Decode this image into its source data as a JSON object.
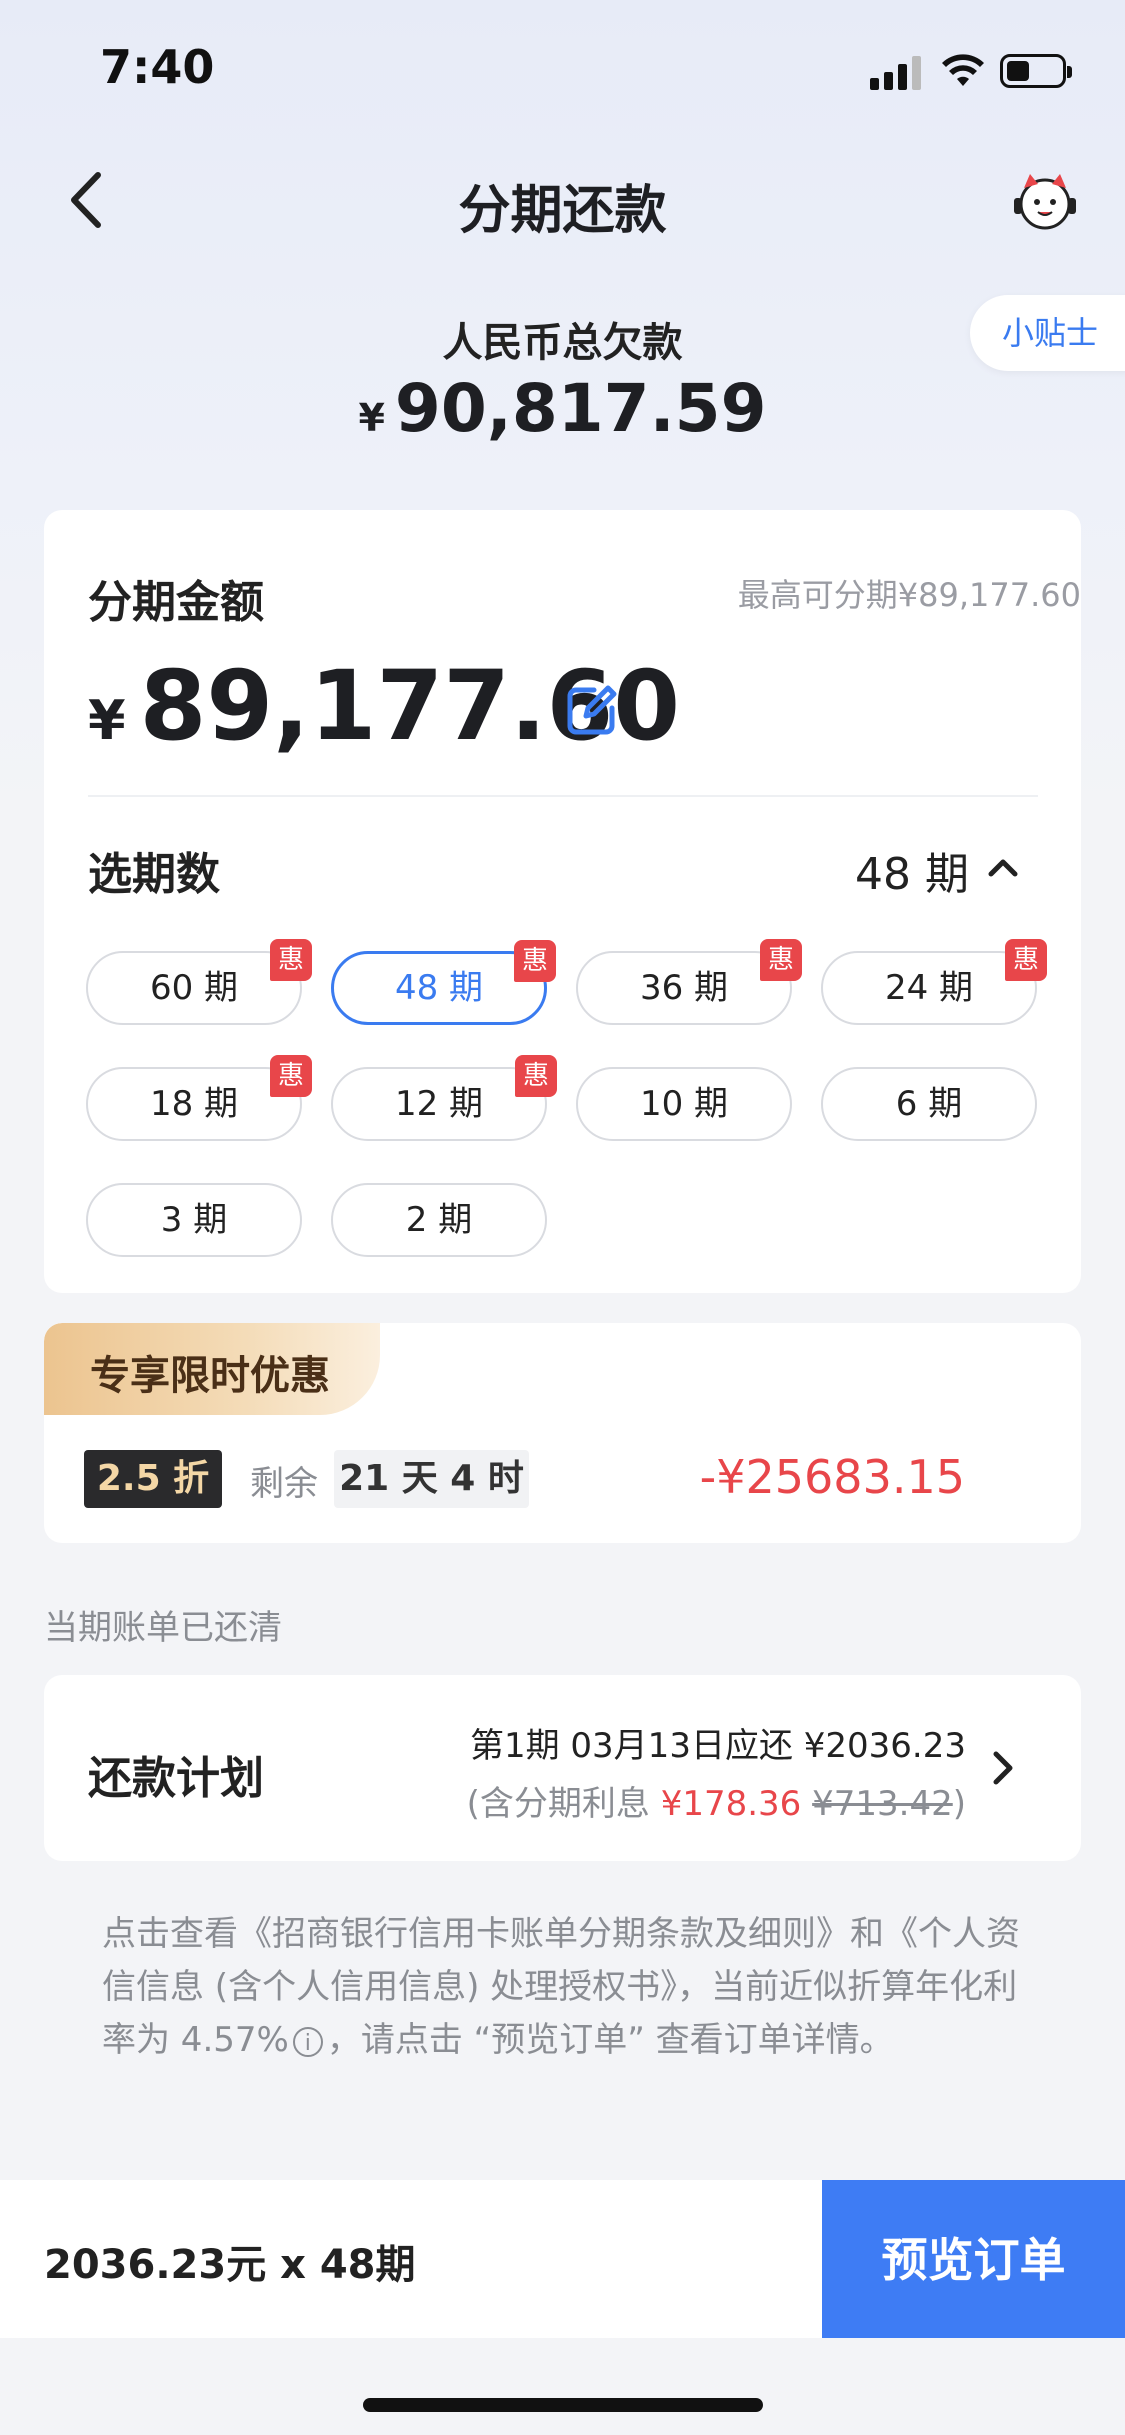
{
  "status_bar": {
    "time": "7:40"
  },
  "nav": {
    "title": "分期还款"
  },
  "header": {
    "tips_label": "小贴士",
    "total_label": "人民币总欠款",
    "currency": "¥",
    "total_amount": "90,817.59"
  },
  "amount_section": {
    "label": "分期金额",
    "max_text": "最高可分期¥89,177.60",
    "currency": "¥",
    "amount": "89,177.60"
  },
  "period_section": {
    "label": "选期数",
    "selected": "48 期",
    "options": [
      {
        "label": "60 期",
        "badge": "惠"
      },
      {
        "label": "48 期",
        "badge": "惠"
      },
      {
        "label": "36 期",
        "badge": "惠"
      },
      {
        "label": "24 期",
        "badge": "惠"
      },
      {
        "label": "18 期",
        "badge": "惠"
      },
      {
        "label": "12 期",
        "badge": "惠"
      },
      {
        "label": "10 期",
        "badge": ""
      },
      {
        "label": "6 期",
        "badge": ""
      },
      {
        "label": "3 期",
        "badge": ""
      },
      {
        "label": "2 期",
        "badge": ""
      }
    ]
  },
  "promo": {
    "title": "专享限时优惠",
    "discount": "2.5 折",
    "remain_label": "剩余",
    "remain_time": "21 天 4 时",
    "saving": "-¥25683.15"
  },
  "bill_notice": "当期账单已还清",
  "plan": {
    "label": "还款计划",
    "line1": "第1期 03月13日应还 ¥2036.23",
    "line2_prefix": "(含分期利息 ",
    "interest": "¥178.36",
    "original_interest": "¥713.42",
    "line2_suffix": ")"
  },
  "terms": {
    "part1": "点击查看《招商银行信用卡账单分期条款及细则》和《个人资信信息 (含个人信用信息) 处理授权书》，当前近似折算年化利率为 4.57%",
    "info_icon": "i",
    "part2": "，请点击 “预览订单” 查看订单详情。"
  },
  "bottom": {
    "summary": "2036.23元 x 48期",
    "button": "预览订单"
  }
}
